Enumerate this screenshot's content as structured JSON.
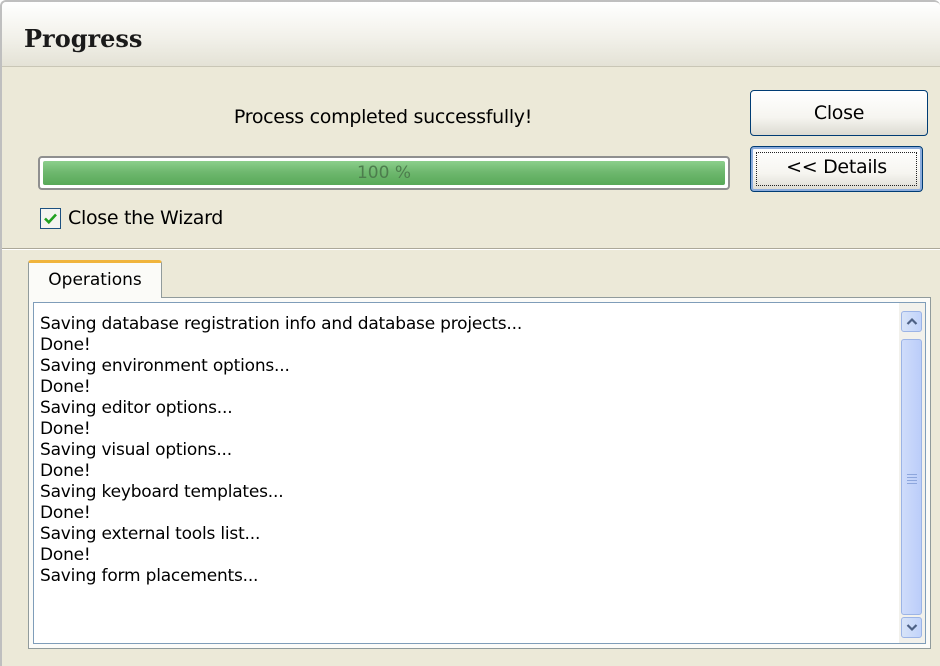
{
  "window": {
    "title": "Progress"
  },
  "status_text": "Process completed successfully!",
  "buttons": {
    "close_label": "Close",
    "details_label": "<< Details"
  },
  "progress": {
    "value_percent": 100,
    "label": "100 %",
    "fill_color": "#6fb86f"
  },
  "options": {
    "close_wizard_label": "Close the Wizard",
    "close_wizard_checked": true
  },
  "tabs": [
    {
      "label": "Operations",
      "active": true
    }
  ],
  "log_lines": [
    "Saving database registration info and database projects...",
    "Done!",
    "Saving environment options...",
    "Done!",
    "Saving editor options...",
    "Done!",
    "Saving visual options...",
    "Done!",
    "Saving keyboard templates...",
    "Done!",
    "Saving external tools list...",
    "Done!",
    "Saving form placements..."
  ],
  "icons": {
    "checkbox": "checkmark-icon",
    "scroll_up": "chevron-up-icon",
    "scroll_down": "chevron-down-icon"
  }
}
